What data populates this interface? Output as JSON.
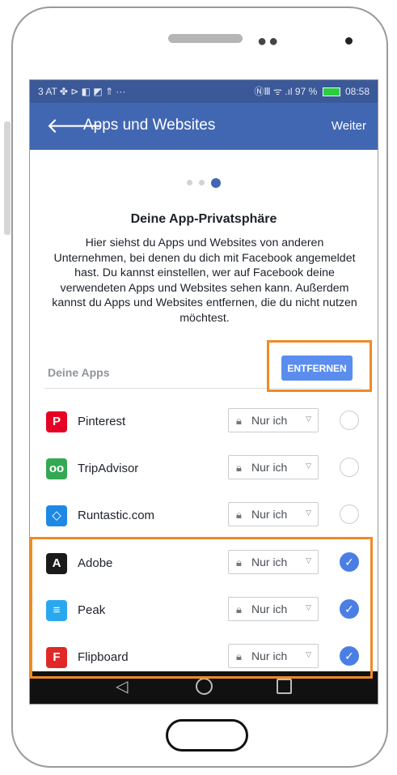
{
  "status_bar": {
    "left": "3 AT ✤ ⊳ ◧ ◩ ⇑ ···",
    "signal": "ⓃⅢ ᯤ .ıl",
    "battery_percent": "97 %",
    "time": "08:58"
  },
  "navbar": {
    "title": "Apps und Websites",
    "next_label": "Weiter"
  },
  "pager": {
    "total": 3,
    "active_index": 3
  },
  "content": {
    "heading": "Deine App-Privatsphäre",
    "description": "Hier siehst du Apps und Websites von anderen Unternehmen, bei denen du dich mit Facebook angemeldet hast. Du kannst einstellen, wer auf Facebook deine verwendeten Apps und Websites sehen kann. Außerdem kannst du Apps und Websites entfernen, die du nicht nutzen möchtest.",
    "apps_label": "Deine Apps",
    "remove_label": "ENTFERNEN"
  },
  "apps": [
    {
      "name": "Pinterest",
      "privacy": "Nur ich",
      "selected": false,
      "icon": "pinterest-icon",
      "icon_color": "#e60023",
      "icon_glyph": "P"
    },
    {
      "name": "TripAdvisor",
      "privacy": "Nur ich",
      "selected": false,
      "icon": "tripadvisor-icon",
      "icon_color": "#34a853",
      "icon_glyph": "oo"
    },
    {
      "name": "Runtastic.com",
      "privacy": "Nur ich",
      "selected": false,
      "icon": "runtastic-icon",
      "icon_color": "#1e88e5",
      "icon_glyph": "◇"
    },
    {
      "name": "Adobe",
      "privacy": "Nur ich",
      "selected": true,
      "icon": "adobe-icon",
      "icon_color": "#1a1a1a",
      "icon_glyph": "A"
    },
    {
      "name": "Peak",
      "privacy": "Nur ich",
      "selected": true,
      "icon": "peak-icon",
      "icon_color": "#29a8f0",
      "icon_glyph": "≡"
    },
    {
      "name": "Flipboard",
      "privacy": "Nur ich",
      "selected": true,
      "icon": "flipboard-icon",
      "icon_color": "#e12828",
      "icon_glyph": "F"
    }
  ],
  "colors": {
    "facebook_blue": "#4267b2",
    "status_bar": "#3b5998",
    "highlight_orange": "#f08a24",
    "check_blue": "#4b7ee5"
  }
}
